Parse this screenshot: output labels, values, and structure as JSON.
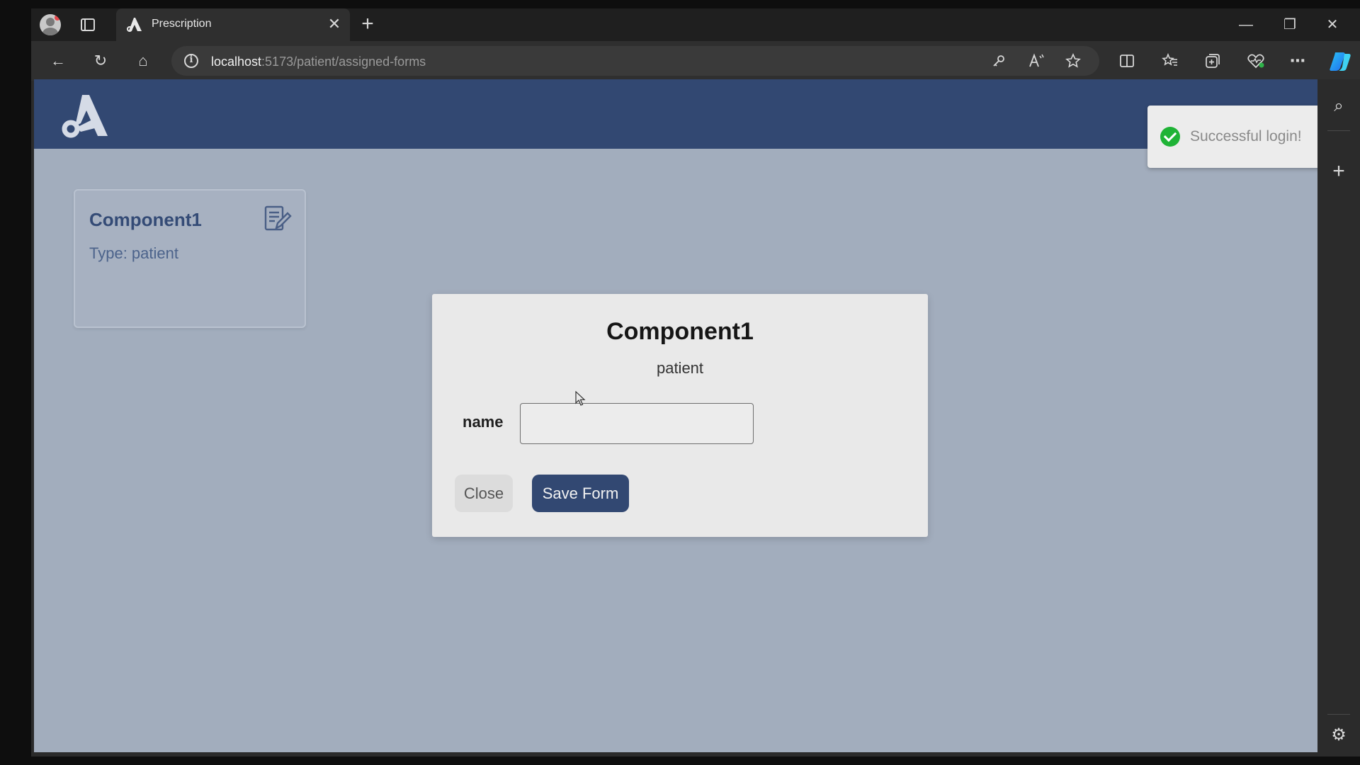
{
  "browser": {
    "tab_title": "Prescription",
    "tab_close": "✕",
    "new_tab": "+",
    "url_host": "localhost",
    "url_rest": ":5173/patient/assigned-forms",
    "window_controls": {
      "minimize": "—",
      "restore": "❐",
      "close": "✕"
    },
    "nav": {
      "back": "←",
      "reload": "↻",
      "home": "⌂"
    },
    "toolbar_icons": [
      "key-icon",
      "read-aloud-icon",
      "favorite-star-icon",
      "split-screen-icon",
      "favorites-icon",
      "collections-icon",
      "browser-essentials-icon",
      "more-icon",
      "copilot-icon"
    ],
    "sidebar": {
      "search": "⌕",
      "add": "+",
      "settings": "⚙"
    }
  },
  "app": {
    "brand_color": "#324872"
  },
  "card": {
    "title": "Component1",
    "type_label": "Type: patient"
  },
  "modal": {
    "title": "Component1",
    "subtitle": "patient",
    "field_label": "name",
    "field_value": "",
    "close_label": "Close",
    "save_label": "Save Form"
  },
  "toast": {
    "message": "Successful login!",
    "status_color": "#1fb336"
  }
}
